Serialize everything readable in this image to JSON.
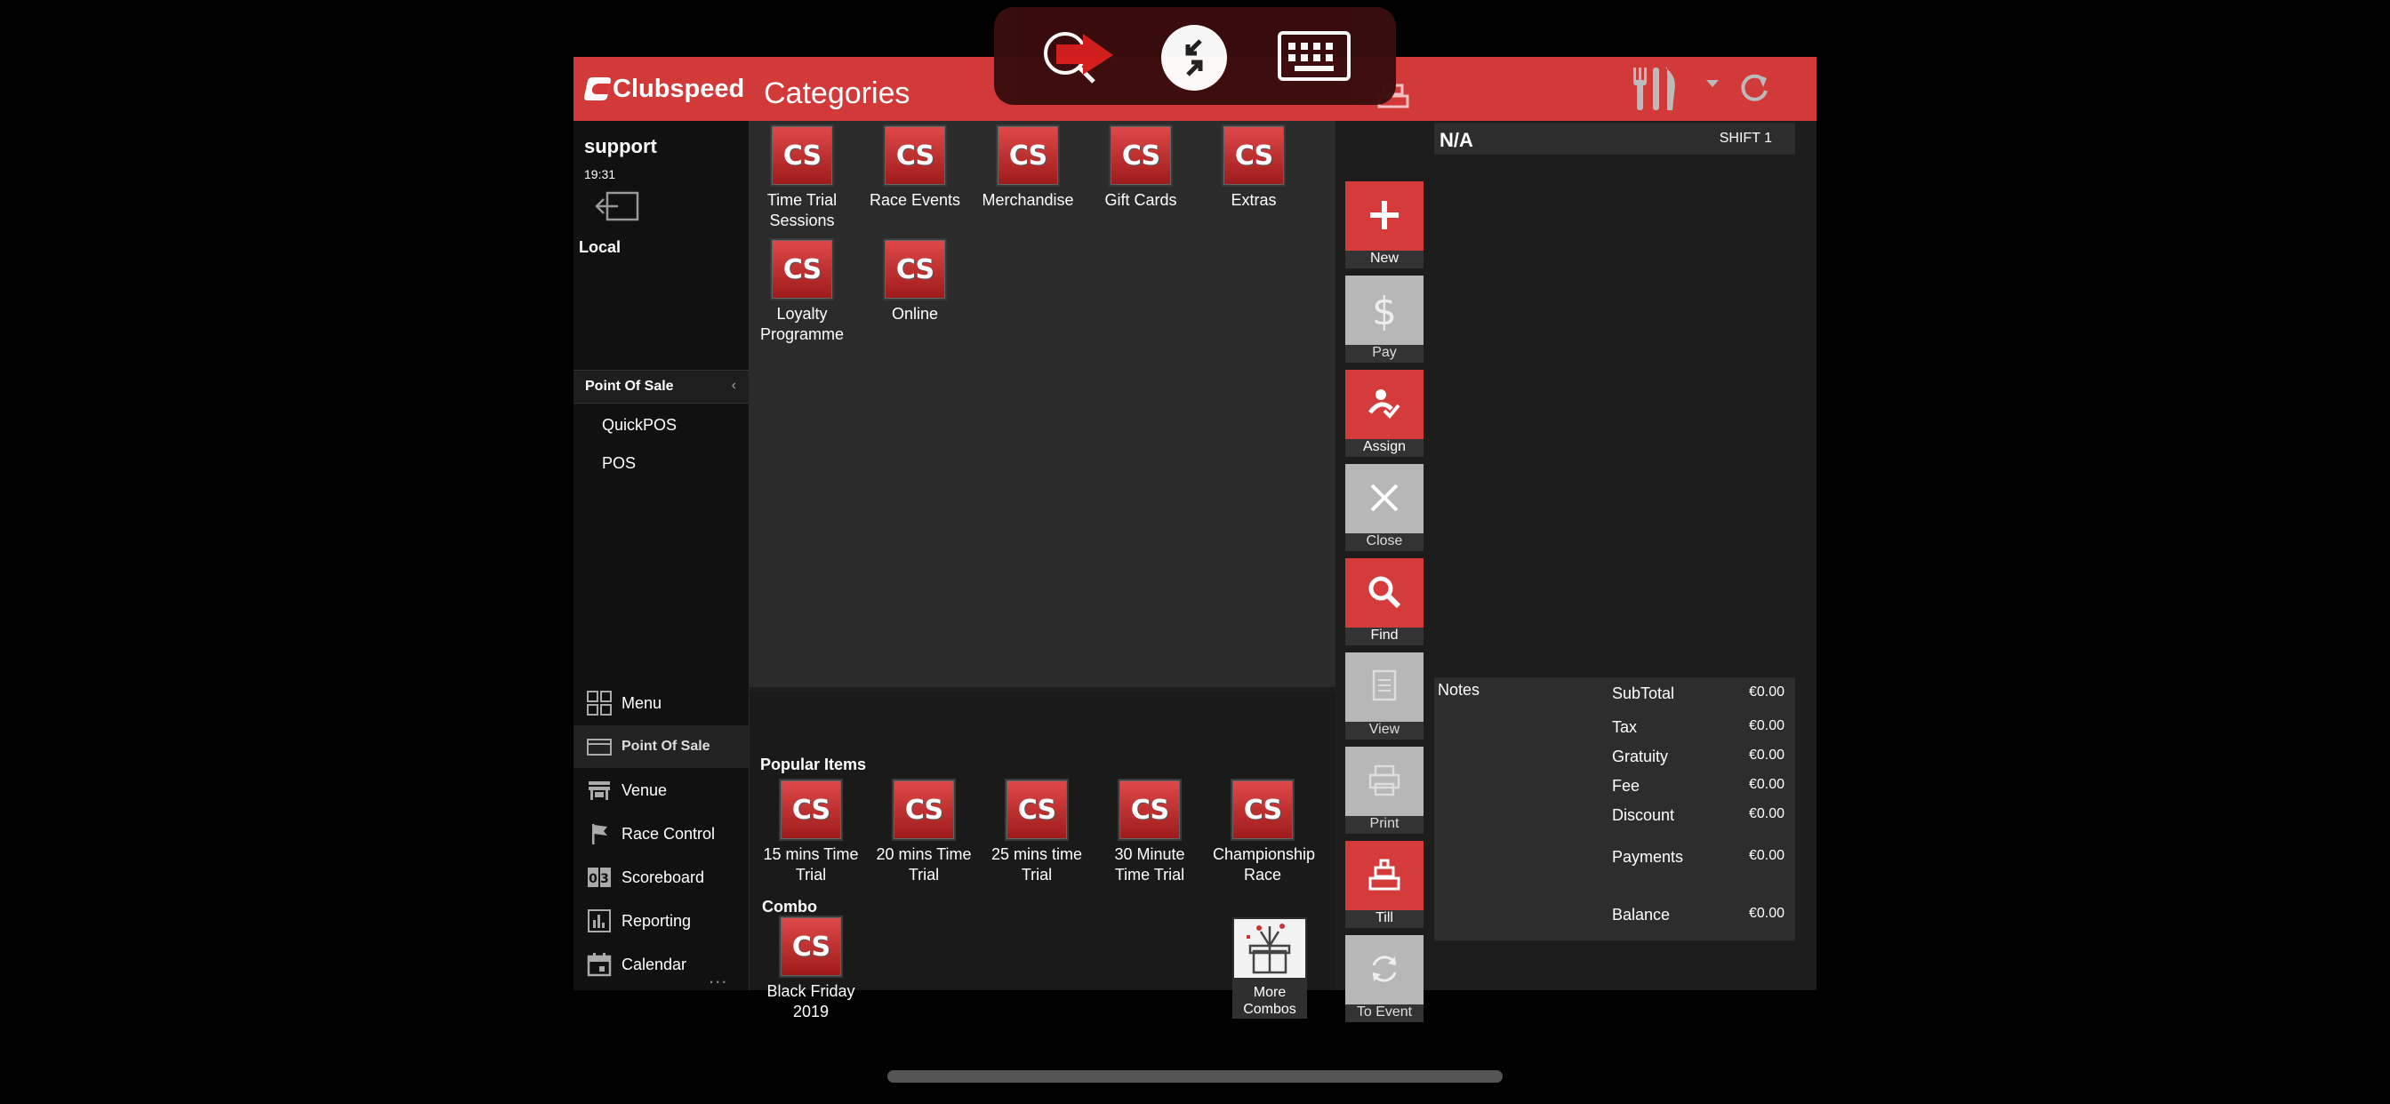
{
  "app": {
    "brand": "Clubspeed",
    "page_title": "Categories"
  },
  "user": {
    "name": "support",
    "time": "19:31",
    "location": "Local"
  },
  "sidebar": {
    "section": "Point Of Sale",
    "sub_items": [
      "QuickPOS",
      "POS"
    ],
    "nav": [
      {
        "label": "Menu",
        "icon": "grid-icon"
      },
      {
        "label": "Point Of Sale",
        "icon": "card-icon"
      },
      {
        "label": "Venue",
        "icon": "store-icon"
      },
      {
        "label": "Race Control",
        "icon": "flag-icon"
      },
      {
        "label": "Scoreboard",
        "icon": "scoreboard-icon"
      },
      {
        "label": "Reporting",
        "icon": "chart-icon"
      },
      {
        "label": "Calendar",
        "icon": "calendar-icon"
      }
    ],
    "more": "..."
  },
  "categories": [
    {
      "label": "Time Trial Sessions",
      "icon_text": "CS"
    },
    {
      "label": "Race Events",
      "icon_text": "CS"
    },
    {
      "label": "Merchandise",
      "icon_text": "CS"
    },
    {
      "label": "Gift Cards",
      "icon_text": "CS"
    },
    {
      "label": "Extras",
      "icon_text": "CS"
    },
    {
      "label": "Loyalty Programme",
      "icon_text": "CS"
    },
    {
      "label": "Online",
      "icon_text": "CS"
    }
  ],
  "popular": {
    "title": "Popular Items",
    "items": [
      {
        "label": "15 mins Time Trial",
        "icon_text": "CS"
      },
      {
        "label": "20 mins Time Trial",
        "icon_text": "CS"
      },
      {
        "label": "25 mins time Trial",
        "icon_text": "CS"
      },
      {
        "label": "30 Minute Time Trial",
        "icon_text": "CS"
      },
      {
        "label": "Championship Race",
        "icon_text": "CS"
      }
    ]
  },
  "combo": {
    "title": "Combo",
    "items": [
      {
        "label": "Black Friday 2019",
        "icon_text": "CS"
      }
    ],
    "more_label": "More Combos"
  },
  "actions": [
    {
      "label": "New",
      "icon": "plus-icon",
      "style": "red"
    },
    {
      "label": "Pay",
      "icon": "dollar-icon",
      "style": "gray"
    },
    {
      "label": "Assign",
      "icon": "assign-icon",
      "style": "red"
    },
    {
      "label": "Close",
      "icon": "close-icon",
      "style": "gray"
    },
    {
      "label": "Find",
      "icon": "search-icon",
      "style": "red"
    },
    {
      "label": "View",
      "icon": "document-icon",
      "style": "gray"
    },
    {
      "label": "Print",
      "icon": "printer-icon",
      "style": "gray"
    },
    {
      "label": "Till",
      "icon": "till-icon",
      "style": "red"
    },
    {
      "label": "To Event",
      "icon": "refresh-icon",
      "style": "gray"
    }
  ],
  "order": {
    "customer": "N/A",
    "shift": "SHIFT 1"
  },
  "totals": {
    "notes_label": "Notes",
    "rows": [
      {
        "label": "SubTotal",
        "value": "€0.00"
      },
      {
        "label": "Tax",
        "value": "€0.00"
      },
      {
        "label": "Gratuity",
        "value": "€0.00"
      },
      {
        "label": "Fee",
        "value": "€0.00"
      },
      {
        "label": "Discount",
        "value": "€0.00"
      },
      {
        "label": "Payments",
        "value": "€0.00"
      },
      {
        "label": "Balance",
        "value": "€0.00"
      }
    ]
  },
  "colors": {
    "brand_red": "#d23a3a",
    "panel": "#2b2b2b",
    "gray_button": "#b7b7b7"
  }
}
